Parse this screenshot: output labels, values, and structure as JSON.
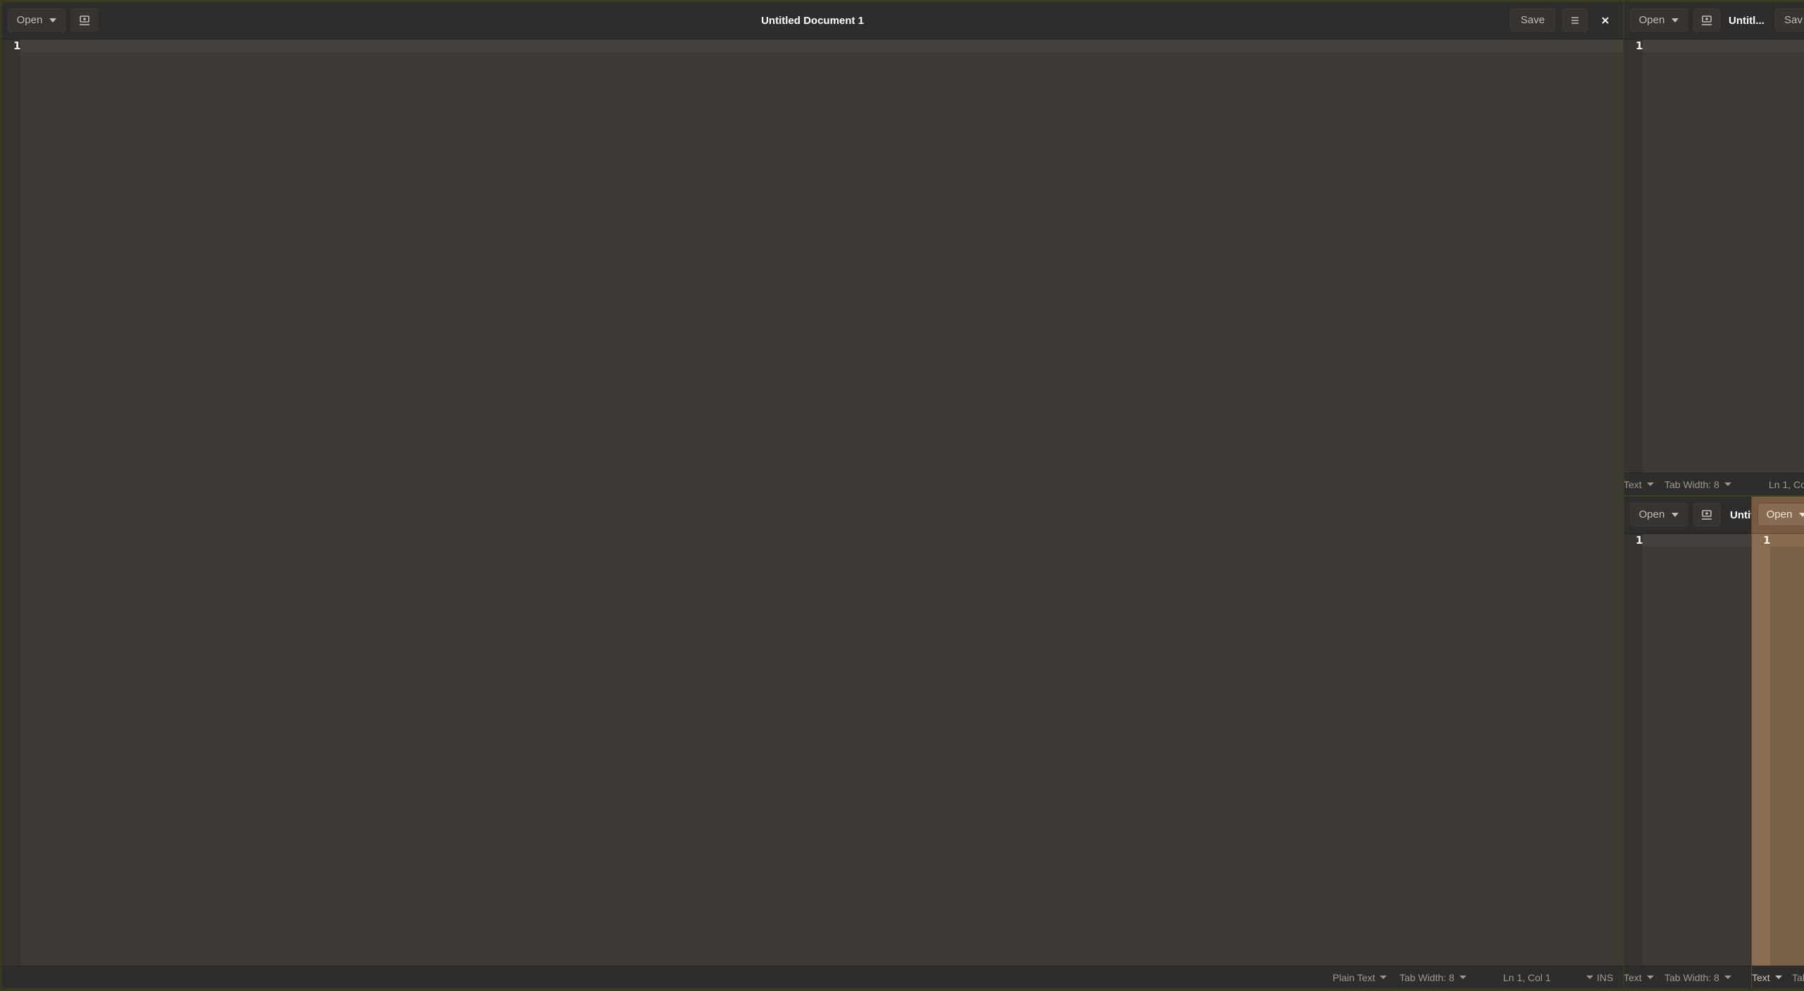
{
  "windows": {
    "main": {
      "open_label": "Open",
      "title": "Untitled Document 1",
      "save_label": "Save",
      "line_number": "1",
      "status": {
        "language": "Plain Text",
        "tab_width": "Tab Width: 8",
        "position": "Ln 1, Col 1",
        "mode": "INS"
      }
    },
    "top_right": {
      "open_label": "Open",
      "title": "Untitl...",
      "save_label": "Sav",
      "line_number": "1",
      "status": {
        "language": "Text",
        "tab_width": "Tab Width: 8",
        "position": "Ln 1, Co"
      }
    },
    "bottom_right_a": {
      "open_label": "Open",
      "title": "Untit",
      "line_number": "1",
      "status": {
        "language": "Text",
        "tab_width": "Tab Width: 8"
      }
    },
    "bottom_right_b": {
      "open_label": "Open",
      "line_number": "1",
      "status": {
        "language": "Text",
        "tab_width": "Tab"
      }
    }
  },
  "icons": {
    "share": "share-icon",
    "menu": "hamburger-menu-icon",
    "close": "close-icon",
    "dropdown": "chevron-down-icon"
  },
  "colors": {
    "header_bg": "#2f2d2b",
    "editor_bg": "#3e3935",
    "gutter_bg": "#363331",
    "tan_window_bg": "#7a5f48",
    "title_text": "#ffffff",
    "status_text": "#9e9892"
  }
}
